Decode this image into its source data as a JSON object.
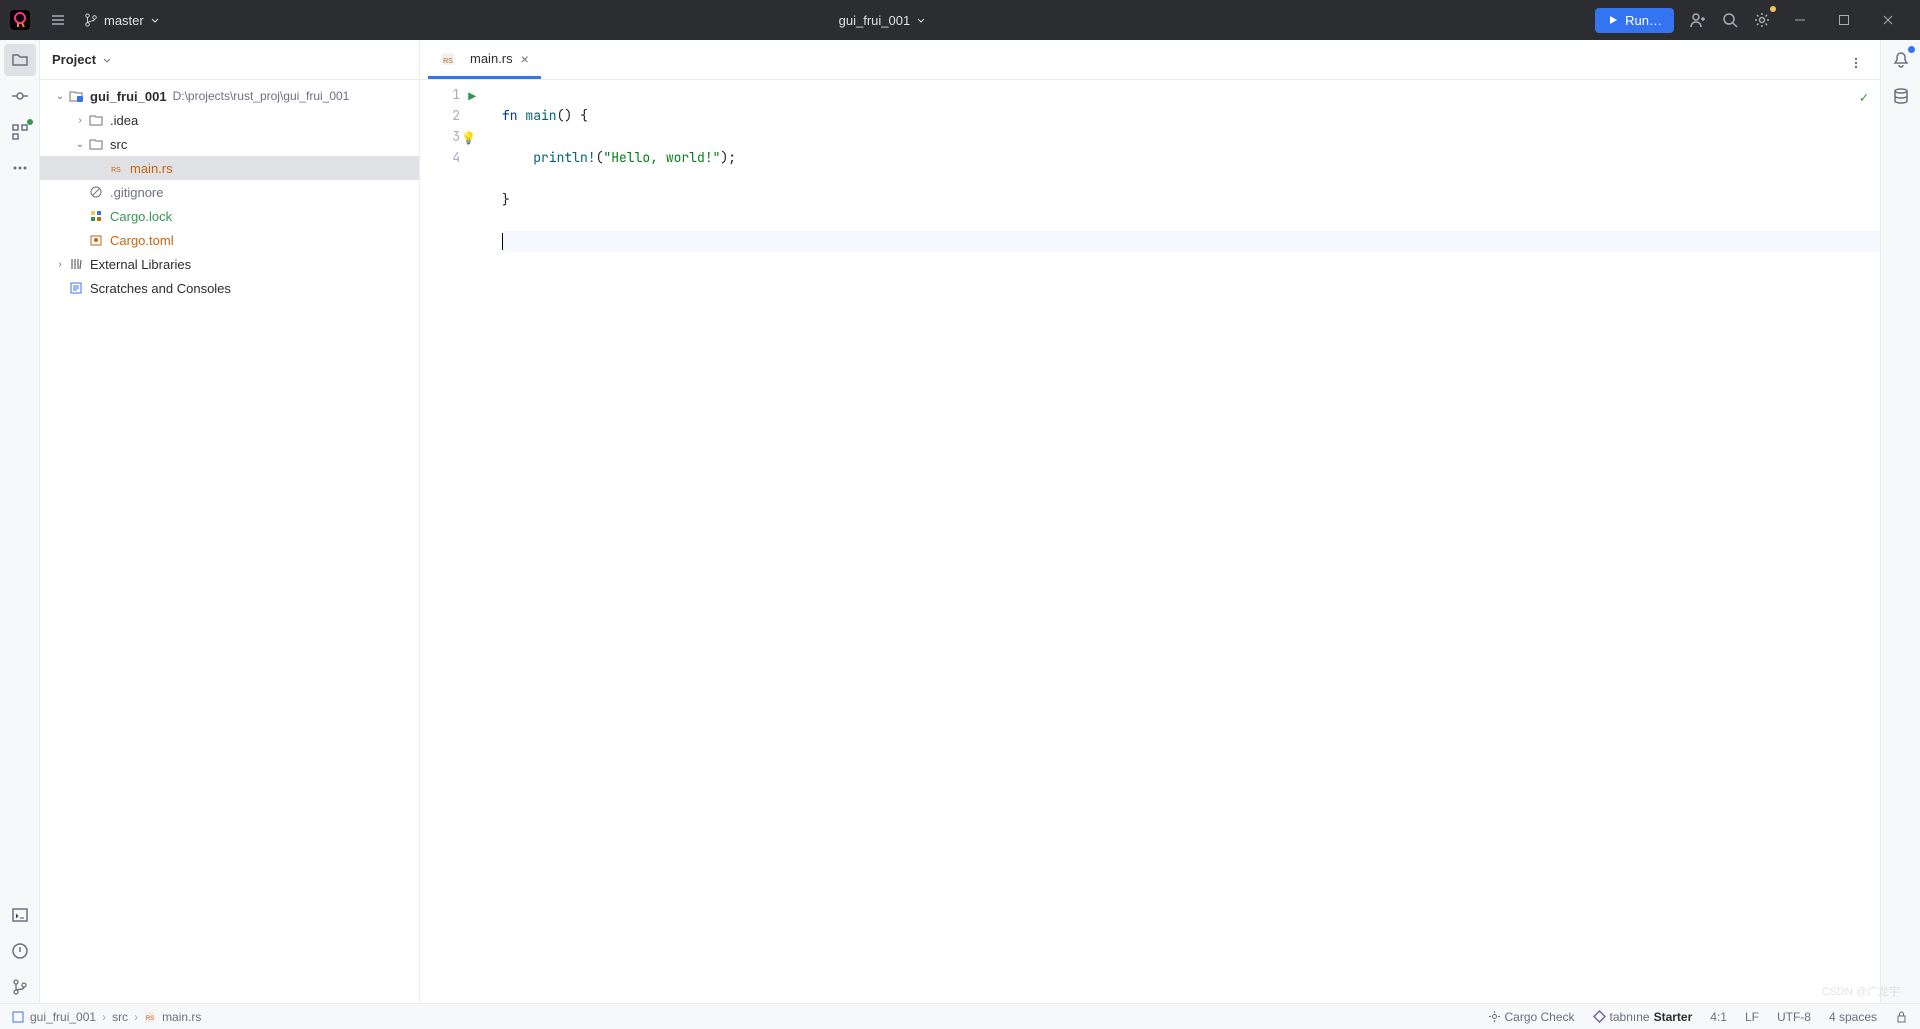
{
  "titlebar": {
    "branch": "master",
    "window_title": "gui_frui_001",
    "run_label": "Run…"
  },
  "panel": {
    "project_label": "Project"
  },
  "tree": {
    "root_name": "gui_frui_001",
    "root_path": "D:\\projects\\rust_proj\\gui_frui_001",
    "idea": ".idea",
    "src": "src",
    "main_rs": "main.rs",
    "gitignore": ".gitignore",
    "cargo_lock": "Cargo.lock",
    "cargo_toml": "Cargo.toml",
    "external_libs": "External Libraries",
    "scratches": "Scratches and Consoles"
  },
  "tabs": {
    "main_rs": "main.rs"
  },
  "code": {
    "l1_kw": "fn ",
    "l1_fn": "main",
    "l1_rest": "() {",
    "l2_indent": "    ",
    "l2_macro": "println!",
    "l2_open": "(",
    "l2_str": "\"Hello, world!\"",
    "l2_close": ");",
    "l3": "}",
    "gutter": {
      "1": "1",
      "2": "2",
      "3": "3",
      "4": "4"
    }
  },
  "status": {
    "bc_root": "gui_frui_001",
    "bc_src": "src",
    "bc_file": "main.rs",
    "cargo_check": "Cargo Check",
    "tabnine": "tabnıne",
    "tabnine_suffix": "Starter",
    "pos": "4:1",
    "line_sep": "LF",
    "encoding": "UTF-8",
    "indent": "4 spaces"
  },
  "watermark": "CSDN @广龙宇"
}
